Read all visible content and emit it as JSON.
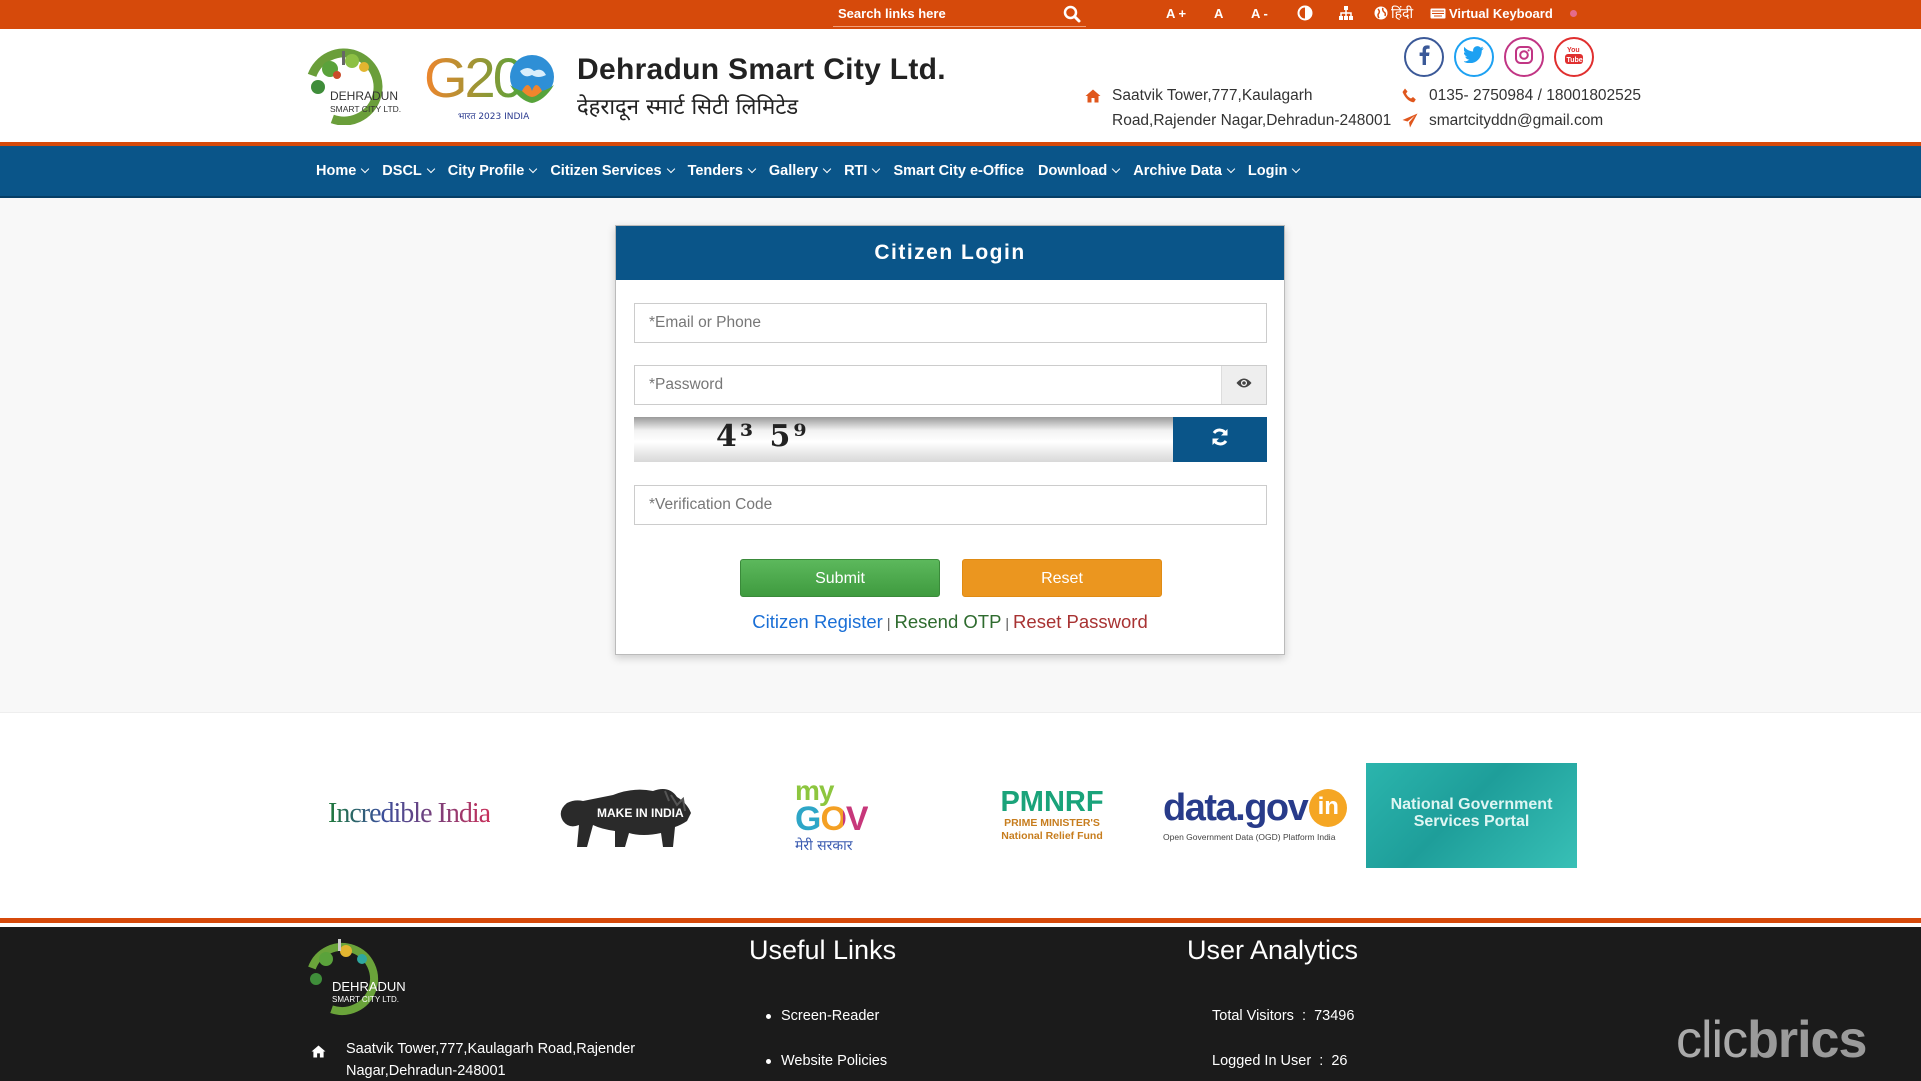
{
  "topbar": {
    "search_placeholder": "Search links here",
    "font_increase": "A +",
    "font_normal": "A",
    "font_decrease": "A -",
    "language": "हिंदी",
    "virtual_keyboard": "Virtual Keyboard"
  },
  "header": {
    "org_logo_text_1": "DEHRADUN",
    "org_logo_text_2": "SMART CITY LTD.",
    "g20_text": "G20",
    "g20_sub": "भारत 2023 INDIA",
    "title": "Dehradun Smart City Ltd.",
    "title_hindi": "देहरादून स्मार्ट सिटी लिमिटेड",
    "address_line1": "Saatvik Tower,777,Kaulagarh",
    "address_line2": "Road,Rajender Nagar,Dehradun-248001",
    "phone": "0135- 2750984 / 18001802525",
    "email": "smartcityddn@gmail.com",
    "social": [
      "facebook",
      "twitter",
      "instagram",
      "youtube"
    ]
  },
  "nav": {
    "items": [
      {
        "label": "Home",
        "dropdown": true
      },
      {
        "label": "DSCL",
        "dropdown": true
      },
      {
        "label": "City Profile",
        "dropdown": true
      },
      {
        "label": "Citizen Services",
        "dropdown": true
      },
      {
        "label": "Tenders",
        "dropdown": true
      },
      {
        "label": "Gallery",
        "dropdown": true
      },
      {
        "label": "RTI",
        "dropdown": true
      },
      {
        "label": "Smart City e-Office",
        "dropdown": false
      },
      {
        "label": "Download",
        "dropdown": true
      },
      {
        "label": "Archive Data",
        "dropdown": true
      },
      {
        "label": "Login",
        "dropdown": true
      }
    ]
  },
  "login": {
    "title": "Citizen Login",
    "email_placeholder": "*Email or Phone",
    "email_value": "",
    "password_placeholder": "*Password",
    "password_value": "",
    "captcha_text": "4³ 5⁹",
    "verification_placeholder": "*Verification Code",
    "verification_value": "",
    "submit_label": "Submit",
    "reset_label": "Reset",
    "register_link": "Citizen Register",
    "resend_otp_link": "Resend OTP",
    "reset_password_link": "Reset Password",
    "separator": "|"
  },
  "partners": {
    "incredible_india": "Incredible India",
    "make_in_india": "MAKE IN INDIA",
    "mygov_my": "my",
    "mygov_gov": "GOV",
    "mygov_hindi": "मेरी सरकार",
    "pmnrf": "PMNRF",
    "pmnrf_sub1": "PRIME MINISTER'S",
    "pmnrf_sub2": "National Relief Fund",
    "datagov": "data.gov",
    "datagov_in": "in",
    "datagov_sub": "Open Government Data (OGD) Platform India",
    "ngsp_line1": "National Government",
    "ngsp_line2": "Services Portal"
  },
  "footer": {
    "logo_text_1": "DEHRADUN",
    "logo_text_2": "SMART CITY LTD.",
    "address_line1": "Saatvik Tower,777,Kaulagarh Road,Rajender",
    "address_line2": "Nagar,Dehradun-248001",
    "useful_links_heading": "Useful Links",
    "useful_links": [
      "Screen-Reader",
      "Website Policies"
    ],
    "analytics_heading": "User Analytics",
    "total_visitors_label": "Total Visitors",
    "total_visitors": "73496",
    "logged_in_label": "Logged In User",
    "logged_in": "26",
    "colon": ":",
    "watermark_light": "clic",
    "watermark_bold": "brics"
  },
  "colors": {
    "topbar": "#d64a0b",
    "nav": "#0a5589",
    "submit": "#4cae4c",
    "reset": "#eb961f",
    "register_link": "#1a6fd6",
    "resend_link": "#2e6b2e",
    "reset_password_link": "#a83232",
    "footer": "#1b1b1b"
  }
}
